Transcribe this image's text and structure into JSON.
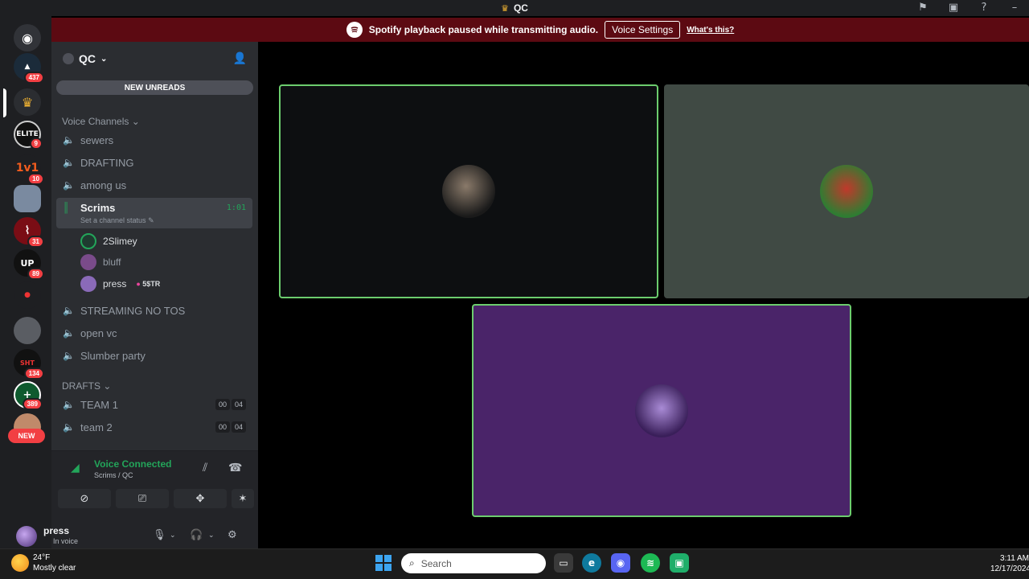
{
  "window": {
    "title": "QC"
  },
  "notice": {
    "message": "Spotify playback paused while transmitting audio.",
    "button": "Voice Settings",
    "link": "What's this?"
  },
  "rail": {
    "badges": [
      "437",
      "9",
      "10",
      "31",
      "89",
      "134",
      "389"
    ],
    "new_label": "NEW"
  },
  "guild": {
    "name": "QC",
    "new_unreads": "NEW UNREADS",
    "category_voice": "Voice Channels",
    "category_drafts": "DRAFTS",
    "channels": [
      "sewers",
      "DRAFTING",
      "among us",
      "Scrims",
      "STREAMING NO TOS",
      "open vc",
      "Slumber party"
    ],
    "active_timer": "1:01",
    "active_status": "Set a channel status",
    "voice_users": [
      {
        "name": "2Slimey",
        "tag": ""
      },
      {
        "name": "bluff",
        "tag": ""
      },
      {
        "name": "press",
        "tag": "5$TR"
      }
    ],
    "drafts": [
      {
        "name": "TEAM 1",
        "count_a": "00",
        "count_b": "04"
      },
      {
        "name": "team 2",
        "count_a": "00",
        "count_b": "04"
      }
    ]
  },
  "voice": {
    "status": "Voice Connected",
    "location": "Scrims / QC"
  },
  "user": {
    "name": "press",
    "status": "In voice"
  },
  "taskbar": {
    "temp": "24°F",
    "weather": "Mostly clear",
    "search_placeholder": "Search",
    "time": "3:11 AM",
    "date": "12/17/2024"
  },
  "colors": {
    "speaking_border": "#6ccd6e",
    "tile_dark": "#0d0f11",
    "tile_gray": "#404a44",
    "tile_purple": "#4a2469",
    "voice_green": "#23a55a",
    "notice_bg": "#5c0a12"
  }
}
